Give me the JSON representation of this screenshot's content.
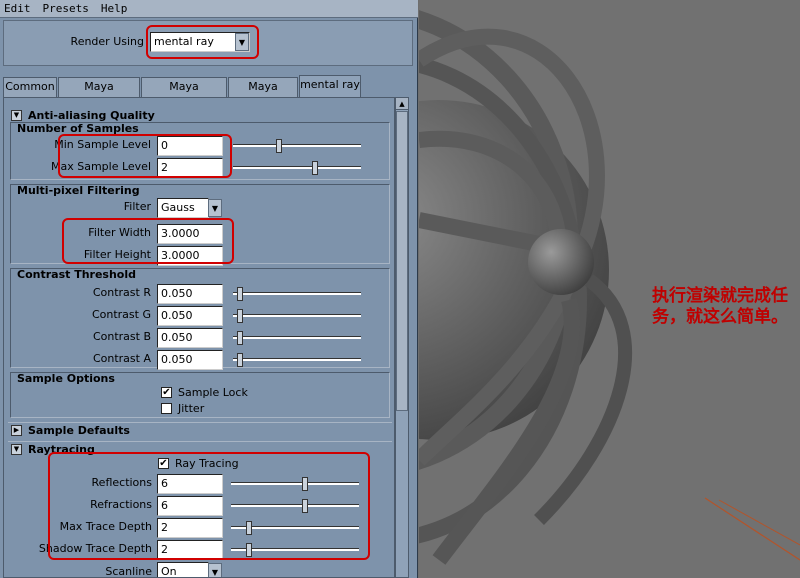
{
  "menu": [
    "Edit",
    "Presets",
    "Help"
  ],
  "render_using": {
    "label": "Render Using",
    "value": "mental ray"
  },
  "tabs": [
    "Common",
    "Maya Software",
    "Maya Hardware",
    "Maya Vector",
    "mental ray"
  ],
  "active_tab": "mental ray",
  "anti_aliasing": {
    "title": "Anti-aliasing Quality",
    "samples": {
      "title": "Number of Samples",
      "min_label": "Min Sample Level",
      "min_value": "0",
      "min_slider": 0.35,
      "max_label": "Max Sample Level",
      "max_value": "2",
      "max_slider": 0.65
    },
    "filtering": {
      "title": "Multi-pixel Filtering",
      "filter_label": "Filter",
      "filter_value": "Gauss",
      "width_label": "Filter Width",
      "width_value": "3.0000",
      "height_label": "Filter Height",
      "height_value": "3.0000"
    },
    "contrast": {
      "title": "Contrast Threshold",
      "r_label": "Contrast R",
      "r_value": "0.050",
      "g_label": "Contrast G",
      "g_value": "0.050",
      "b_label": "Contrast B",
      "b_value": "0.050",
      "a_label": "Contrast A",
      "a_value": "0.050"
    },
    "sample_options": {
      "title": "Sample Options",
      "lock_label": "Sample Lock",
      "lock_checked": true,
      "jitter_label": "Jitter",
      "jitter_checked": false
    }
  },
  "sample_defaults": {
    "title": "Sample Defaults"
  },
  "raytracing": {
    "title": "Raytracing",
    "ray_tracing_label": "Ray Tracing",
    "ray_tracing_checked": true,
    "reflections_label": "Reflections",
    "reflections_value": "6",
    "refractions_label": "Refractions",
    "refractions_value": "6",
    "max_depth_label": "Max Trace Depth",
    "max_depth_value": "2",
    "shadow_depth_label": "Shadow Trace Depth",
    "shadow_depth_value": "2",
    "scanline_label": "Scanline",
    "scanline_value": "On"
  },
  "annotation": "执行渲染就完成任务，就这么简单。"
}
